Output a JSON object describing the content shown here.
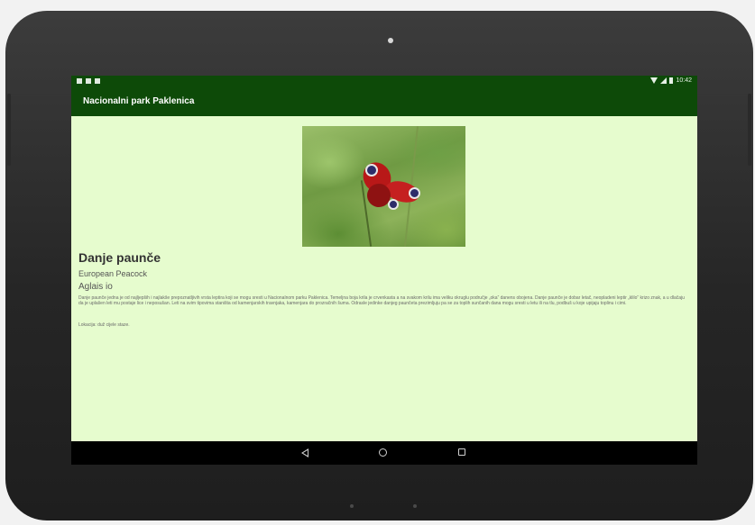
{
  "status_bar": {
    "time": "10:42"
  },
  "app_bar": {
    "title": "Nacionalni park Paklenica"
  },
  "detail": {
    "name": "Danje paunče",
    "english_name": "European Peacock",
    "latin_name": "Aglais io",
    "description": "Danje paunče jedna je od najljepših i najlakše prepoznatljivih vrsta leptira koji se mogu sresti u Nacionalnom parku Paklenica. Temeljna boja krila je crvenkasta a na svakom krilu ima veliku okruglu područje „oka“ danens obojena. Danje paunče je dobar letač, neopladeni leptir „klilo“ krizo znak, a u dlačaju da je uplašen leti mu postaje lice i neposušan. Leti na svim tipovima staništa od kamenjarskih travnjaka, kamenjara do prozračnih šuma. Odrasle jedinke danjeg paunčeta prezimljuju pa se za toplih sunčanih dana mogu sresti u letu ili na tlu, podbuš u koje upijaju toplinu i cimi.",
    "location": "Lokacija: duž cijele staze."
  },
  "photo": {
    "subject": "peacock butterfly on grass stem"
  },
  "navigation": {
    "back": "back-icon",
    "home": "home-icon",
    "recents": "recents-icon"
  },
  "colors": {
    "app_bar": "#0d4a08",
    "background": "#e6fcce"
  }
}
